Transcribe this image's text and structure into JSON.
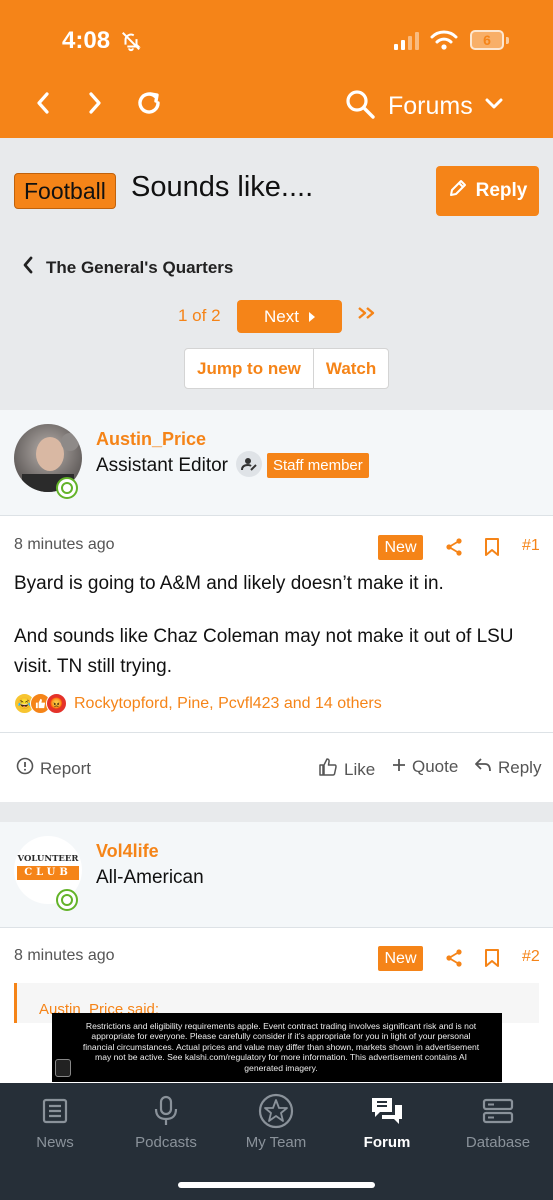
{
  "status": {
    "time": "4:08",
    "battery": "6"
  },
  "navbar": {
    "forums_label": "Forums"
  },
  "thread": {
    "prefix": "Football",
    "title": "Sounds like....",
    "reply_label": "Reply",
    "breadcrumb": "The General's Quarters",
    "pager": {
      "current": "1 of 2",
      "next_label": "Next"
    },
    "jump_label": "Jump to new",
    "watch_label": "Watch"
  },
  "posts": [
    {
      "username": "Austin_Price",
      "user_title": "Assistant Editor",
      "staff_label": "Staff member",
      "time": "8 minutes ago",
      "new_label": "New",
      "number": "#1",
      "body": [
        "Byard is going to A&M and likely doesn’t make it in.",
        "And sounds like Chaz Coleman may not make it out of LSU visit. TN still trying."
      ],
      "reaction_users": "Rockytopford, Pine, Pcvfl423 and 14 others",
      "actions": {
        "report": "Report",
        "like": "Like",
        "quote": "Quote",
        "reply": "Reply"
      }
    },
    {
      "username": "Vol4life",
      "user_title": "All-American",
      "avatar_text": [
        "VOLUNTEER",
        "CLUB"
      ],
      "time": "8 minutes ago",
      "new_label": "New",
      "number": "#2",
      "quote_author": "Austin_Price said:"
    }
  ],
  "ad": {
    "text": "Restrictions and eligibility requirements apple. Event contract trading involves significant risk and is not appropriate for everyone. Please carefully consider if it’s appropriate for you in light of your personal financial circumstances. Actual prices and value may differ than shown, markets shown in advertisement may not be active. See kalshi.com/regulatory for more information. This advertisement contains AI generated imagery."
  },
  "tabs": [
    {
      "label": "News",
      "icon": "news-icon"
    },
    {
      "label": "Podcasts",
      "icon": "microphone-icon"
    },
    {
      "label": "My Team",
      "icon": "star-icon"
    },
    {
      "label": "Forum",
      "icon": "chat-bubbles-icon",
      "active": true
    },
    {
      "label": "Database",
      "icon": "database-icon"
    }
  ],
  "colors": {
    "accent": "#f58418",
    "tabbar": "#262f38",
    "online": "#63b329"
  }
}
